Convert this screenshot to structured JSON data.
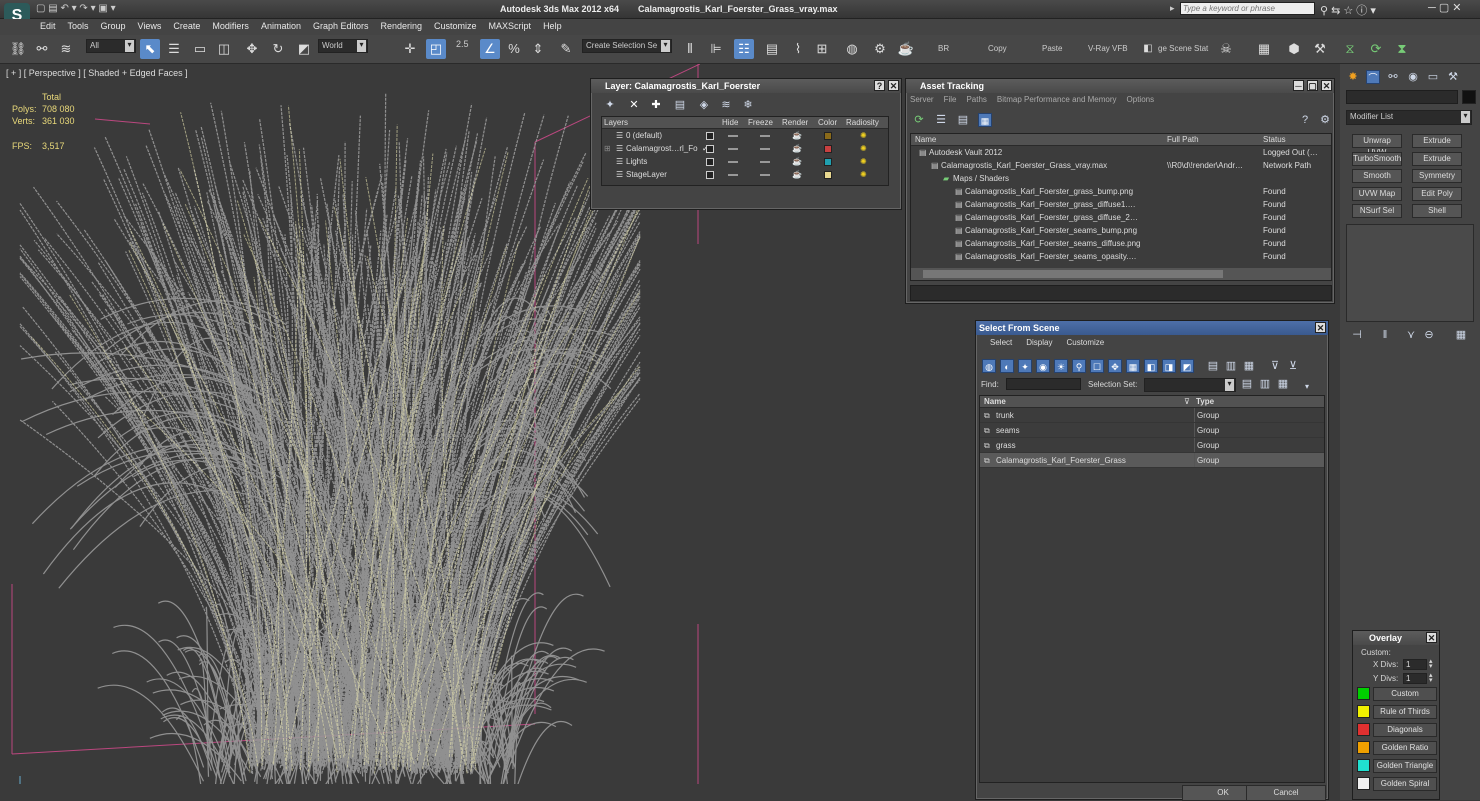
{
  "title": {
    "app": "Autodesk 3ds Max  2012 x64",
    "file": "Calamagrostis_Karl_Foerster_Grass_vray.max",
    "search_placeholder": "Type a keyword or phrase"
  },
  "menu": [
    "Edit",
    "Tools",
    "Group",
    "Views",
    "Create",
    "Modifiers",
    "Animation",
    "Graph Editors",
    "Rendering",
    "Customize",
    "MAXScript",
    "Help"
  ],
  "toolbar": {
    "filter": "All",
    "coord": "World",
    "snap_value": "2.5",
    "selection_set": "Create Selection Se",
    "br": "BR",
    "copy": "Copy",
    "paste": "Paste",
    "vray_vfb": "V-Ray VFB",
    "scene_states": "ge Scene Stat"
  },
  "viewport": {
    "label": "[ + ] [ Perspective ] [ Shaded + Edged Faces ]",
    "total": "Total",
    "polys_label": "Polys:",
    "polys": "708 080",
    "verts_label": "Verts:",
    "verts": "361 030",
    "fps_label": "FPS:",
    "fps": "3,517"
  },
  "layer_window": {
    "title": "Layer: Calamagrostis_Karl_Foerster",
    "columns": [
      "Layers",
      "Hide",
      "Freeze",
      "Render",
      "Color",
      "Radiosity"
    ],
    "rows": [
      {
        "name": "0 (default)",
        "color": "#8a6a1a",
        "current": false
      },
      {
        "name": "Calamagrost…rl_Fo",
        "color": "#c84040",
        "current": true
      },
      {
        "name": "Lights",
        "color": "#20a0b0",
        "current": false
      },
      {
        "name": "StageLayer",
        "color": "#e8d890",
        "current": false
      }
    ]
  },
  "asset_window": {
    "title": "Asset Tracking",
    "menu": [
      "Server",
      "File",
      "Paths",
      "Bitmap Performance and Memory",
      "Options"
    ],
    "columns": [
      "Name",
      "Full Path",
      "Status"
    ],
    "rows": [
      {
        "name": "Autodesk Vault 2012",
        "path": "",
        "status": "Logged Out (…",
        "indent": 1
      },
      {
        "name": "Calamagrostis_Karl_Foerster_Grass_vray.max",
        "path": "\\\\R0\\d\\!render\\Andr…",
        "status": "Network Path",
        "indent": 2
      },
      {
        "name": "Maps / Shaders",
        "path": "",
        "status": "",
        "indent": 3
      },
      {
        "name": "Calamagrostis_Karl_Foerster_grass_bump.png",
        "path": "",
        "status": "Found",
        "indent": 4
      },
      {
        "name": "Calamagrostis_Karl_Foerster_grass_diffuse1.…",
        "path": "",
        "status": "Found",
        "indent": 4
      },
      {
        "name": "Calamagrostis_Karl_Foerster_grass_diffuse_2…",
        "path": "",
        "status": "Found",
        "indent": 4
      },
      {
        "name": "Calamagrostis_Karl_Foerster_seams_bump.png",
        "path": "",
        "status": "Found",
        "indent": 4
      },
      {
        "name": "Calamagrostis_Karl_Foerster_seams_diffuse.png",
        "path": "",
        "status": "Found",
        "indent": 4
      },
      {
        "name": "Calamagrostis_Karl_Foerster_seams_opasity.…",
        "path": "",
        "status": "Found",
        "indent": 4
      }
    ]
  },
  "select_window": {
    "title": "Select From Scene",
    "menu": [
      "Select",
      "Display",
      "Customize"
    ],
    "find_label": "Find:",
    "selset_label": "Selection Set:",
    "columns": [
      "Name",
      "Type"
    ],
    "rows": [
      {
        "name": "trunk",
        "type": "Group"
      },
      {
        "name": "seams",
        "type": "Group"
      },
      {
        "name": "grass",
        "type": "Group"
      },
      {
        "name": "Calamagrostis_Karl_Foerster_Grass",
        "type": "Group"
      }
    ],
    "ok": "OK",
    "cancel": "Cancel"
  },
  "command_panel": {
    "modifier_list": "Modifier List",
    "buttons": [
      "Unwrap UVW",
      "Extrude",
      "TurboSmooth",
      "Extrude",
      "Smooth",
      "Symmetry",
      "UVW Map",
      "Edit Poly",
      "NSurf Sel",
      "Shell"
    ]
  },
  "overlay": {
    "title": "Overlay",
    "custom_label": "Custom:",
    "xdivs_label": "X Divs:",
    "xdivs": "1",
    "ydivs_label": "Y Divs:",
    "ydivs": "1",
    "items": [
      {
        "label": "Custom",
        "color": "#00d000"
      },
      {
        "label": "Rule of Thirds",
        "color": "#f0f000"
      },
      {
        "label": "Diagonals",
        "color": "#e03030"
      },
      {
        "label": "Golden Ratio",
        "color": "#f0a000"
      },
      {
        "label": "Golden Triangle",
        "color": "#20e0d0"
      },
      {
        "label": "Golden Spiral",
        "color": "#f0f0f0"
      }
    ]
  }
}
